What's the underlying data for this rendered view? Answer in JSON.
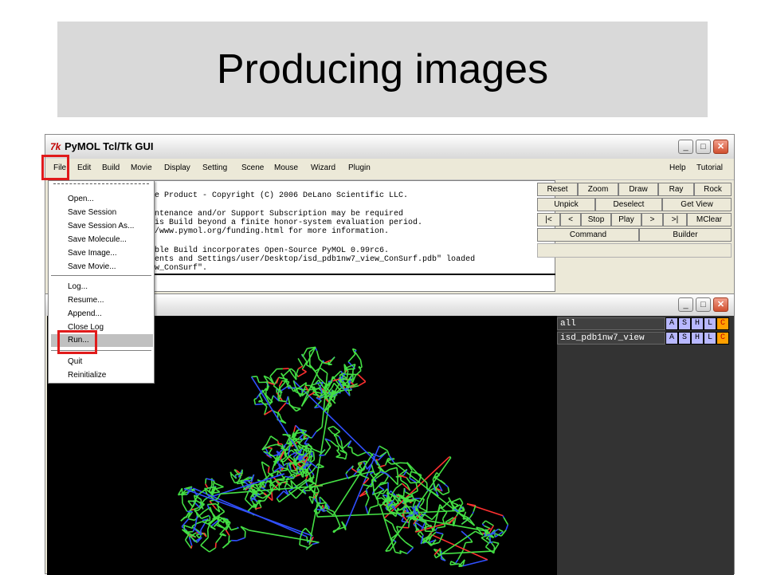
{
  "slide": {
    "title": "Producing images"
  },
  "gui_window": {
    "app_icon": "7k",
    "title": "PyMOL Tcl/Tk GUI",
    "controls": {
      "minimize": "_",
      "maximize": "□",
      "close": "✕"
    },
    "menu": [
      "File",
      "Edit",
      "Build",
      "Movie",
      "Display",
      "Setting",
      "Scene",
      "Mouse",
      "Wizard",
      "Plugin"
    ],
    "menu_right": [
      "Help",
      "Tutorial"
    ],
    "console_lines": [
      "ve Product - Copyright (C) 2006 DeLano Scientific LLC.",
      "intenance and/or Support Subscription may be required",
      "his Build beyond a finite honor-system evaluation period.",
      "//www.pymol.org/funding.html for more information.",
      "able Build incorporates Open-Source PyMOL 0.99rc6.",
      "ments and Settings/user/Desktop/isd_pdb1nw7_view_ConSurf.pdb\" loaded",
      "ew_ConSurf\"."
    ],
    "buttons": {
      "row1": [
        "Reset",
        "Zoom",
        "Draw",
        "Ray",
        "Rock"
      ],
      "row2": [
        "Unpick",
        "Deselect",
        "Get View"
      ],
      "row3": [
        "|<",
        "<",
        "Stop",
        "Play",
        ">",
        ">|",
        "MClear"
      ],
      "row4": [
        "Command",
        "Builder"
      ]
    }
  },
  "file_menu": {
    "tearoff": "- - - - - - - - -",
    "items": [
      "Open...",
      "Save Session",
      "Save Session As...",
      "Save Molecule...",
      "Save Image...",
      "Save Movie...",
      "Log...",
      "Resume...",
      "Append...",
      "Close Log",
      "Run...",
      "Quit",
      "Reinitialize"
    ],
    "active_item": "Run..."
  },
  "viewer_window": {
    "controls": {
      "minimize": "_",
      "maximize": "□",
      "close": "✕"
    },
    "objects": [
      {
        "name": "all",
        "buttons": [
          "A",
          "S",
          "H",
          "L",
          "C"
        ]
      },
      {
        "name": "isd_pdb1nw7_view",
        "buttons": [
          "A",
          "S",
          "H",
          "L",
          "C"
        ]
      }
    ],
    "button_colors": {
      "A": "#b8b8ff",
      "S": "#b8b8ff",
      "H": "#b8b8ff",
      "L": "#b8b8ff",
      "C": "#ffa000"
    }
  },
  "colors": {
    "highlight_red": "#e01b1b",
    "molecule_green": "#44e044",
    "molecule_blue": "#3050ff",
    "molecule_red": "#ff3030"
  }
}
